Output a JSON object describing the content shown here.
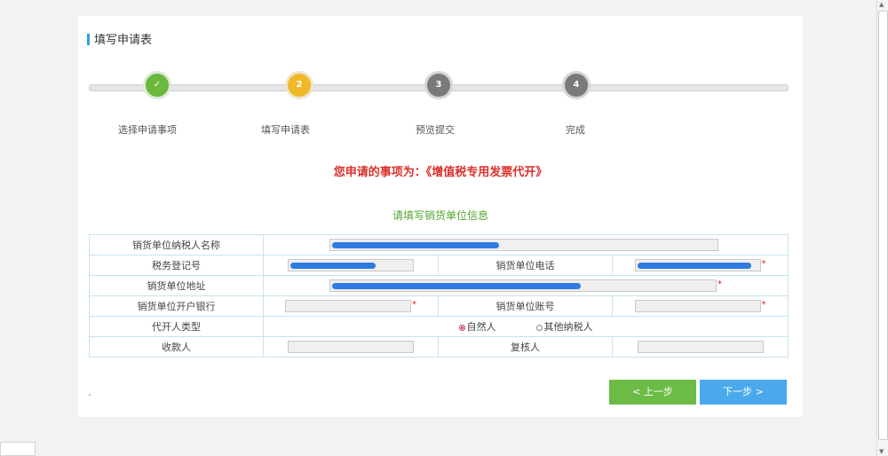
{
  "page": {
    "title": "填写申请表"
  },
  "steps": [
    {
      "number": "✓",
      "label": "选择申请事项",
      "state": "done"
    },
    {
      "number": "2",
      "label": "填写申请表",
      "state": "current"
    },
    {
      "number": "3",
      "label": "预览提交",
      "state": "todo"
    },
    {
      "number": "4",
      "label": "完成",
      "state": "todo"
    }
  ],
  "notice": "您申请的事项为：《增值税专用发票代开》",
  "section_title": "请填写销货单位信息",
  "form": {
    "seller_name_label": "销货单位纳税人名称",
    "tax_id_label": "税务登记号",
    "phone_label": "销货单位电话",
    "address_label": "销货单位地址",
    "bank_label": "销货单位开户银行",
    "account_label": "销货单位账号",
    "agent_type_label": "代开人类型",
    "agent_options": [
      "自然人",
      "其他纳税人"
    ],
    "payee_label": "收款人",
    "reviewer_label": "复核人",
    "required_mark": "*"
  },
  "buttons": {
    "prev": "< 上一步",
    "next": "下一步 >"
  },
  "colors": {
    "accent_blue": "#4aa9ec",
    "accent_green": "#6cbb46",
    "notice_red": "#d9302b",
    "step_current": "#f0b92a"
  }
}
